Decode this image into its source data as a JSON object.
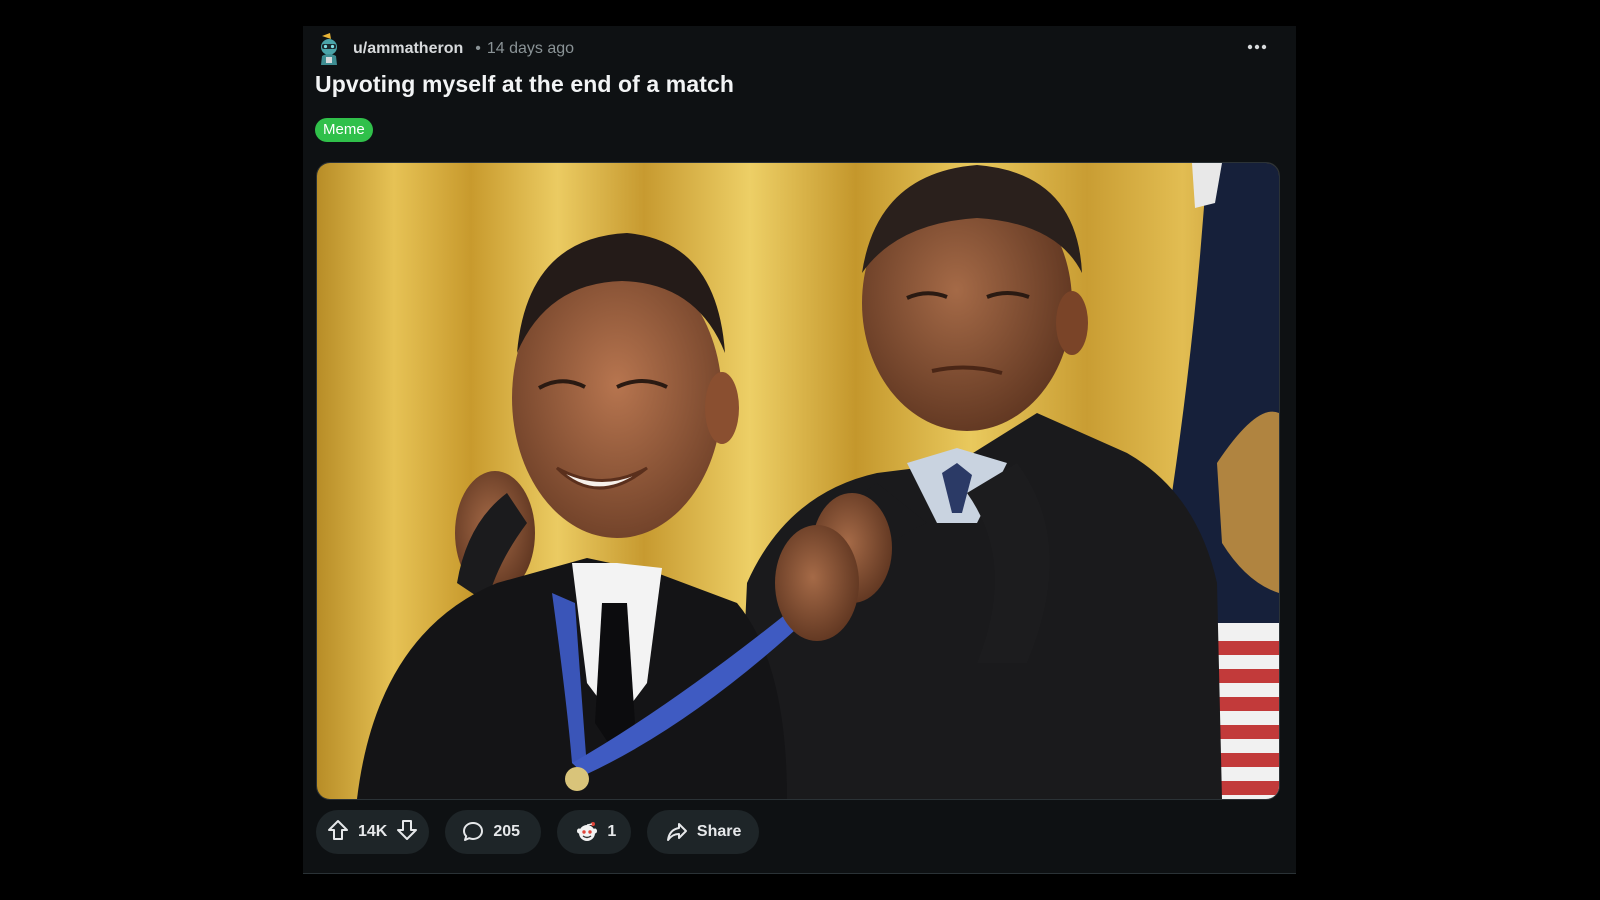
{
  "post": {
    "username": "u/ammatheron",
    "separator": "•",
    "timestamp": "14 days ago",
    "title": "Upvoting myself at the end of a match",
    "flair": "Meme"
  },
  "actions": {
    "upvote_count": "14K",
    "comment_count": "205",
    "award_count": "1",
    "share_label": "Share"
  },
  "icons": {
    "avatar": "snoo-avatar-icon",
    "more": "ellipsis-icon",
    "upvote": "arrow-up-icon",
    "downvote": "arrow-down-icon",
    "comment": "speech-bubble-icon",
    "award": "award-icon",
    "share": "share-arrow-icon"
  },
  "colors": {
    "page_background": "#000000",
    "card_background": "#0e1113",
    "pill_background": "#1e2528",
    "flair_green": "#30c04a",
    "text_primary": "#f2f4f5",
    "text_secondary": "#8a9396"
  }
}
